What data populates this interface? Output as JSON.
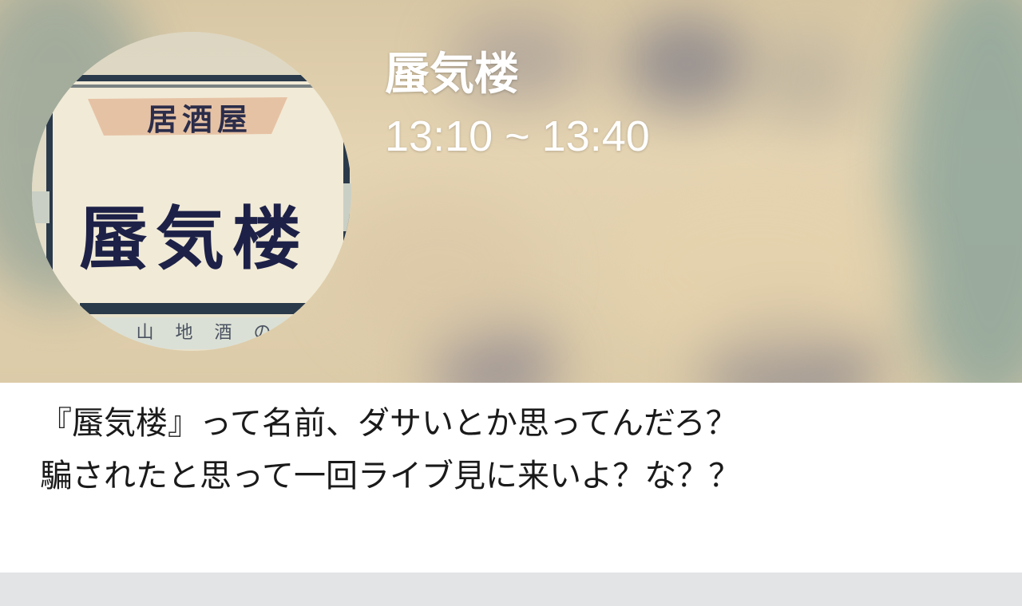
{
  "header": {
    "venue_name": "蜃気楼",
    "time_range": "13:10 ~ 13:40"
  },
  "avatar": {
    "sign_top": "居酒屋",
    "sign_main": "蜃気楼",
    "sign_bottom": "山 地 酒 の"
  },
  "comment": {
    "lines": [
      "『蜃気楼』って名前、ダサいとか思ってんだろ？",
      "騙されたと思って一回ライブ見に来いよ？な？？"
    ]
  }
}
